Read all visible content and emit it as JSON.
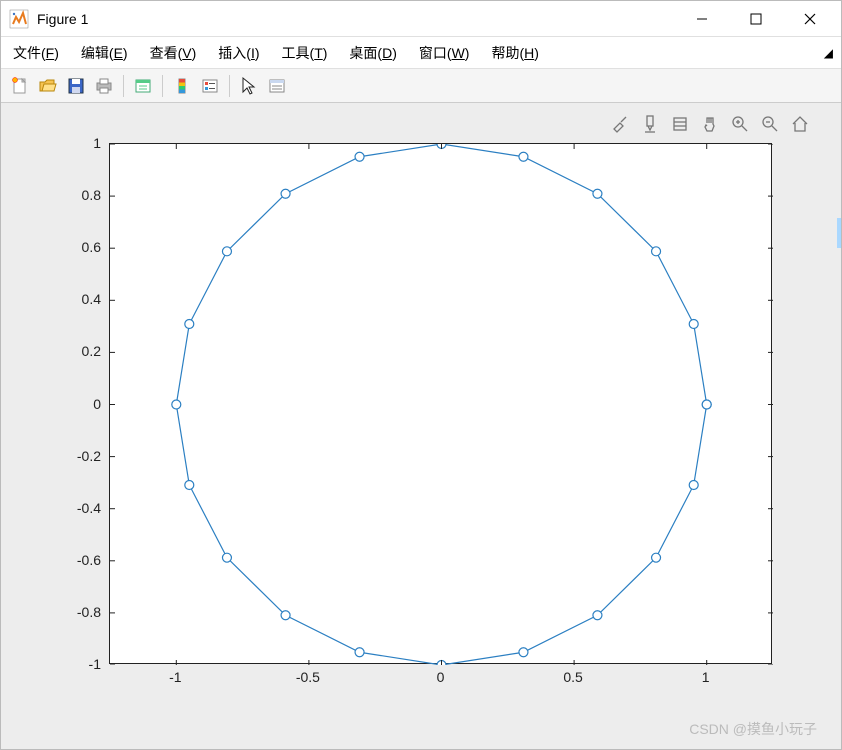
{
  "window": {
    "title": "Figure 1"
  },
  "menu": {
    "file": "文件(",
    "file_u": "F",
    "file_end": ")",
    "edit": "编辑(",
    "edit_u": "E",
    "edit_end": ")",
    "view": "查看(",
    "view_u": "V",
    "view_end": ")",
    "insert": "插入(",
    "insert_u": "I",
    "insert_end": ")",
    "tools": "工具(",
    "tools_u": "T",
    "tools_end": ")",
    "desktop": "桌面(",
    "desktop_u": "D",
    "desktop_end": ")",
    "window": "窗口(",
    "window_u": "W",
    "window_end": ")",
    "help": "帮助(",
    "help_u": "H",
    "help_end": ")"
  },
  "chart_data": {
    "type": "line",
    "x": [
      1.0,
      0.951,
      0.809,
      0.588,
      0.309,
      0.0,
      -0.309,
      -0.588,
      -0.809,
      -0.951,
      -1.0,
      -0.951,
      -0.809,
      -0.588,
      -0.309,
      0.0,
      0.309,
      0.588,
      0.809,
      0.951,
      1.0
    ],
    "y": [
      0.0,
      0.309,
      0.588,
      0.809,
      0.951,
      1.0,
      0.951,
      0.809,
      0.588,
      0.309,
      0.0,
      -0.309,
      -0.588,
      -0.809,
      -0.951,
      -1.0,
      -0.951,
      -0.809,
      -0.588,
      -0.309,
      0.0
    ],
    "xlim": [
      -1.25,
      1.25
    ],
    "ylim": [
      -1.0,
      1.0
    ],
    "xticks": [
      -1,
      -0.5,
      0,
      0.5,
      1
    ],
    "yticks": [
      -1,
      -0.8,
      -0.6,
      -0.4,
      -0.2,
      0,
      0.2,
      0.4,
      0.6,
      0.8,
      1
    ],
    "marker": "o",
    "line_color": "#2b7fc2",
    "title": "",
    "xlabel": "",
    "ylabel": ""
  },
  "watermark": "CSDN @摸鱼小玩子"
}
